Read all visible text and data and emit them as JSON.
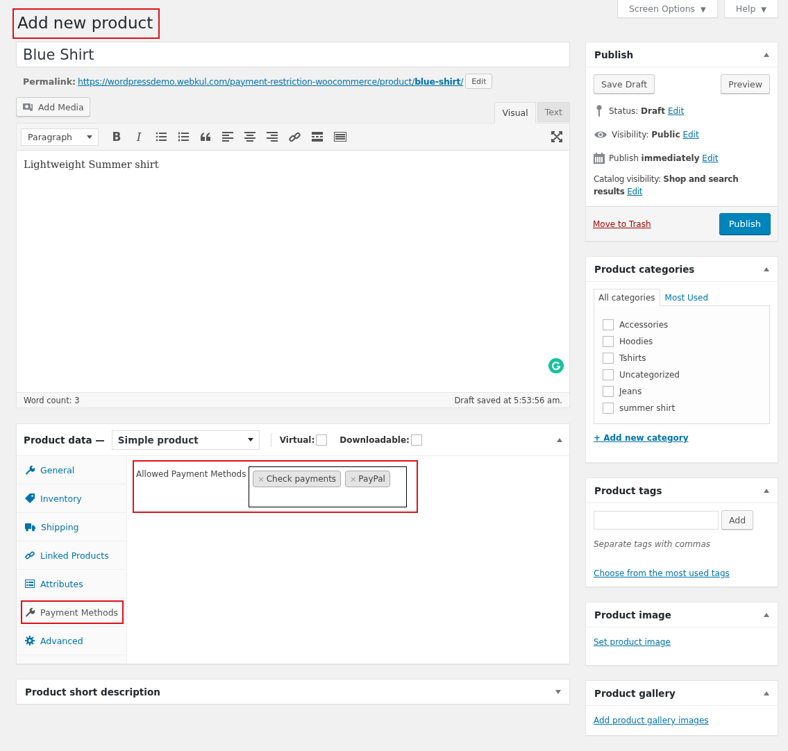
{
  "header_buttons": [
    {
      "label": "Screen Options",
      "caret": "▼"
    },
    {
      "label": "Help",
      "caret": "▼"
    }
  ],
  "page_title": {
    "text": "Add new product",
    "highlighted": true
  },
  "product_title": "Blue Shirt",
  "permalink": {
    "label": "Permalink:",
    "url": "https://wordpressdemo.webkul.com/payment-restriction-woocommerce/product/**blue-shirt**/",
    "edit": "Edit"
  },
  "editor": {
    "add_media": "Add Media",
    "tabs": [
      {
        "label": "Visual",
        "selected": true
      },
      {
        "label": "Text",
        "selected": false
      }
    ],
    "format": "Paragraph",
    "toolbar": [
      {
        "kind": "bold",
        "label": "B"
      },
      {
        "kind": "italic",
        "label": "I"
      },
      {
        "kind": "bullets"
      },
      {
        "kind": "numbers"
      },
      {
        "kind": "quote"
      },
      {
        "kind": "align-left"
      },
      {
        "kind": "align-center"
      },
      {
        "kind": "align-right"
      },
      {
        "kind": "link"
      },
      {
        "kind": "more"
      },
      {
        "kind": "toolbar"
      }
    ],
    "content": "Lightweight Summer shirt",
    "word_count": "Word count: 3",
    "draft_saved": "Draft saved at 5:53:56 am."
  },
  "product_data": {
    "title": "Product data —",
    "type": "Simple product",
    "expanded": true,
    "options": [
      {
        "label": "Virtual:",
        "checked": false
      },
      {
        "label": "Downloadable:",
        "checked": false
      }
    ],
    "tabs": [
      {
        "label": "General",
        "kind": "wrench",
        "selected": false,
        "highlighted": false
      },
      {
        "label": "Inventory",
        "kind": "tag",
        "selected": false,
        "highlighted": false
      },
      {
        "label": "Shipping",
        "kind": "truck",
        "selected": false,
        "highlighted": false
      },
      {
        "label": "Linked Products",
        "kind": "link",
        "selected": false,
        "highlighted": false
      },
      {
        "label": "Attributes",
        "kind": "list",
        "selected": false,
        "highlighted": false
      },
      {
        "label": "Payment Methods",
        "kind": "wrench",
        "selected": true,
        "highlighted": true
      },
      {
        "label": "Advanced",
        "kind": "gear",
        "selected": false,
        "highlighted": false
      }
    ],
    "field": {
      "label": "Allowed Payment Methods",
      "highlighted": true,
      "tokens": [
        {
          "remove": "×",
          "label": "Check payments"
        },
        {
          "remove": "×",
          "label": "PayPal"
        }
      ]
    }
  },
  "short_description": {
    "title": "Product short description",
    "expanded": false
  },
  "sidebar": [
    {
      "kind": "publish",
      "title": "Publish",
      "expanded": true,
      "save_draft": "Save Draft",
      "preview": "Preview",
      "rows": [
        {
          "kind": "pin",
          "text": "Status: **Draft**",
          "link": "Edit"
        },
        {
          "kind": "eye",
          "text": "Visibility: **Public**",
          "link": "Edit"
        },
        {
          "kind": "calendar",
          "text": "Publish **immediately**",
          "link": "Edit"
        }
      ],
      "catalog": {
        "text": "Catalog visibility: **Shop and search results**",
        "link": "Edit"
      },
      "trash": "Move to Trash",
      "publish": "Publish"
    },
    {
      "kind": "categories",
      "title": "Product categories",
      "expanded": true,
      "tabs": [
        {
          "label": "All categories",
          "selected": true
        },
        {
          "label": "Most Used",
          "selected": false
        }
      ],
      "items": [
        {
          "label": "Accessories",
          "checked": false
        },
        {
          "label": "Hoodies",
          "checked": false
        },
        {
          "label": "Tshirts",
          "checked": false
        },
        {
          "label": "Uncategorized",
          "checked": false
        },
        {
          "label": "Jeans",
          "checked": false
        },
        {
          "label": "summer shirt",
          "checked": false
        }
      ],
      "add_link": "+ Add new category"
    },
    {
      "kind": "tags",
      "title": "Product tags",
      "expanded": true,
      "add": "Add",
      "hint": "Separate tags with commas",
      "link": "Choose from the most used tags"
    },
    {
      "kind": "image",
      "title": "Product image",
      "expanded": true,
      "link": "Set product image"
    },
    {
      "kind": "gallery",
      "title": "Product gallery",
      "expanded": true,
      "link": "Add product gallery images"
    }
  ]
}
